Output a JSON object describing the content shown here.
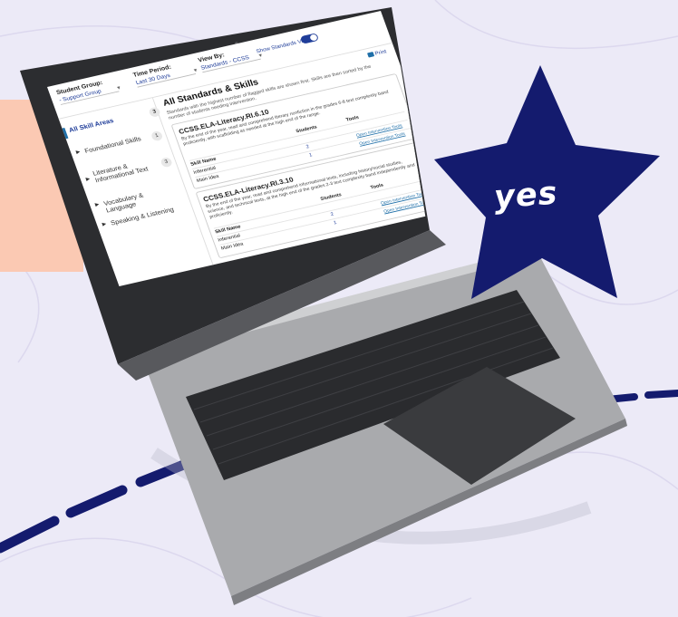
{
  "filters": {
    "student_group_label": "Student Group:",
    "student_group_value": "- Support Group",
    "time_period_label": "Time Period:",
    "time_period_value": "Last 30 Days",
    "view_by_label": "View By:",
    "view_by_value": "Standards - CCSS",
    "standards_toggle_label": "Show Standards View"
  },
  "sidebar": {
    "items": [
      {
        "label": "All Skill Areas",
        "count": "3"
      },
      {
        "label": "Foundational Skills",
        "count": "1"
      },
      {
        "label": "Literature & Informational Text",
        "count": "3"
      },
      {
        "label": "Vocabulary & Language",
        "count": ""
      },
      {
        "label": "Speaking & Listening",
        "count": ""
      }
    ]
  },
  "main": {
    "title": "All Standards & Skills",
    "print_label": "Print",
    "subtitle": "Standards with the highest number of flagged skills are shown first. Skills are then sorted by the number of students needing intervention.",
    "cards": [
      {
        "standard": "CCSS.ELA-Literacy.RI.6.10",
        "description": "By the end of the year, read and comprehend literary nonfiction in the grades 6-8 text complexity band proficiently, with scaffolding as needed at the high end of the range.",
        "col_skill": "Skill Name",
        "col_students": "Students",
        "col_tools": "Tools",
        "rows": [
          {
            "skill": "Inferential",
            "students": "2",
            "tool": "Open Intervention Tools"
          },
          {
            "skill": "Main Idea",
            "students": "1",
            "tool": "Open Intervention Tools"
          }
        ]
      },
      {
        "standard": "CCSS.ELA-Literacy.RI.3.10",
        "description": "By the end of the year, read and comprehend informational texts, including history/social studies, science, and technical texts, at the high end of the grades 2-3 text complexity band independently and proficiently.",
        "col_skill": "Skill Name",
        "col_students": "Students",
        "col_tools": "Tools",
        "rows": [
          {
            "skill": "Inferential",
            "students": "2",
            "tool": "Open Intervention Tools"
          },
          {
            "skill": "Main Idea",
            "students": "1",
            "tool": "Open Intervention Tools"
          }
        ]
      }
    ]
  },
  "star": {
    "text": "yes",
    "color": "#141b6e"
  },
  "colors": {
    "background": "#eceaf7",
    "accent_navy": "#141b6e",
    "panel_salmon": "#fbc9b3",
    "link_blue": "#1f3d99"
  }
}
